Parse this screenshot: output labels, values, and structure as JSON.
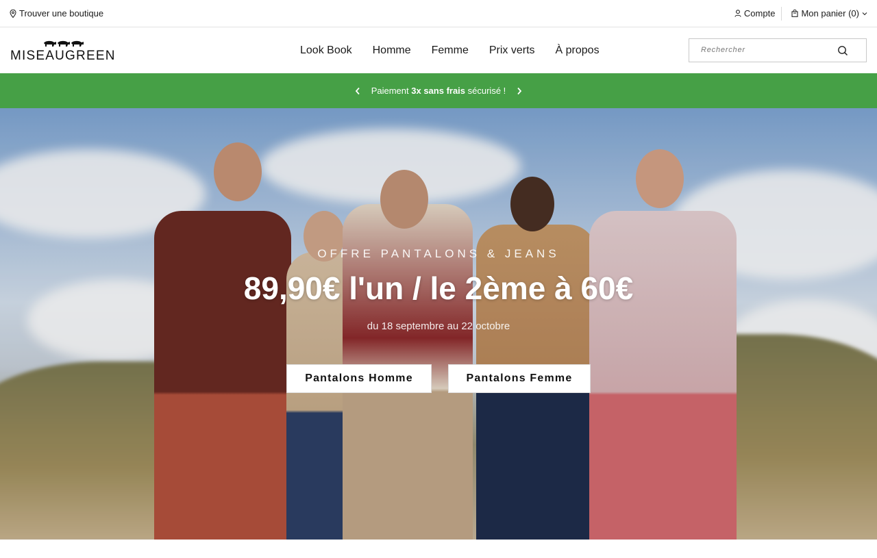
{
  "topbar": {
    "store_finder": "Trouver une boutique",
    "account": "Compte",
    "cart": "Mon panier (0)"
  },
  "header": {
    "logo_text": "MISEAUGREEN",
    "nav": [
      "Look Book",
      "Homme",
      "Femme",
      "Prix verts",
      "À propos"
    ],
    "search_placeholder": "Rechercher"
  },
  "promo": {
    "prefix": "Paiement ",
    "bold": "3x sans frais",
    "suffix": " sécurisé !"
  },
  "hero": {
    "eyebrow": "OFFRE PANTALONS & JEANS",
    "headline": "89,90€ l'un / le 2ème à 60€",
    "dates": "du 18 septembre au 22 octobre",
    "cta_homme": "Pantalons Homme",
    "cta_femme": "Pantalons Femme"
  },
  "colors": {
    "promo_green": "#46a046",
    "text": "#1a1a1a"
  },
  "icons": [
    "location-pin-icon",
    "user-icon",
    "shopping-bag-icon",
    "chevron-down-icon",
    "search-icon",
    "chevron-left-icon",
    "chevron-right-icon",
    "animal-logo-icon"
  ]
}
